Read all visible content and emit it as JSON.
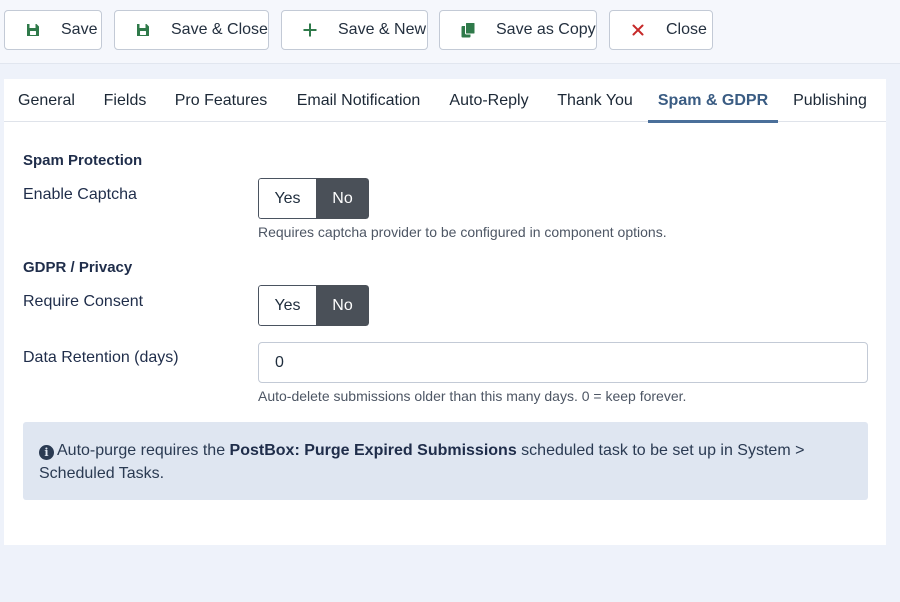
{
  "toolbar": {
    "save": "Save",
    "save_close": "Save & Close",
    "save_new": "Save & New",
    "save_copy": "Save as Copy",
    "close": "Close"
  },
  "tabs": [
    "General",
    "Fields",
    "Pro Features",
    "Email Notification",
    "Auto-Reply",
    "Thank You",
    "Spam & GDPR",
    "Publishing"
  ],
  "active_tab": "Spam & GDPR",
  "spam": {
    "title": "Spam Protection",
    "captcha_label": "Enable Captcha",
    "captcha_value": "No",
    "captcha_help": "Requires captcha provider to be configured in component options."
  },
  "gdpr": {
    "title": "GDPR / Privacy",
    "consent_label": "Require Consent",
    "consent_value": "No",
    "retention_label": "Data Retention (days)",
    "retention_value": "0",
    "retention_help": "Auto-delete submissions older than this many days. 0 = keep forever."
  },
  "toggle": {
    "yes": "Yes",
    "no": "No"
  },
  "alert": {
    "prefix": "Auto-purge requires the ",
    "task": "PostBox: Purge Expired Submissions",
    "suffix": " scheduled task to be set up in System > Scheduled Tasks."
  },
  "colors": {
    "accent": "#4a6f9a",
    "save_icon": "#2f7a4a",
    "close_icon": "#c62828",
    "toggle_active": "#4a5058",
    "alert_bg": "#dfe6f1"
  },
  "icons": {
    "save": "floppy-disk-icon",
    "save_close": "floppy-disk-icon",
    "save_new": "plus-icon",
    "save_copy": "copy-icon",
    "close": "close-x-icon",
    "alert": "info-circle-icon"
  }
}
